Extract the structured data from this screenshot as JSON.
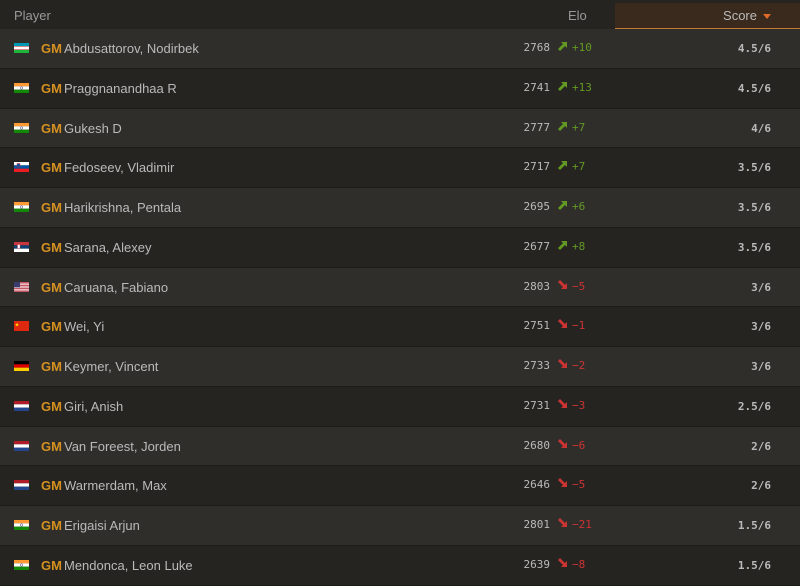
{
  "header": {
    "player": "Player",
    "elo": "Elo",
    "score": "Score"
  },
  "colors": {
    "title": "#d59120",
    "up": "#629924",
    "down": "#cc3333",
    "accent": "#e06a2a"
  },
  "rows": [
    {
      "flag": "uz",
      "title": "GM",
      "name": "Abdusattorov, Nodirbek",
      "elo": "2768",
      "dir": "up",
      "delta": "+10",
      "score": "4.5/6"
    },
    {
      "flag": "in",
      "title": "GM",
      "name": "Praggnanandhaa R",
      "elo": "2741",
      "dir": "up",
      "delta": "+13",
      "score": "4.5/6"
    },
    {
      "flag": "in",
      "title": "GM",
      "name": "Gukesh D",
      "elo": "2777",
      "dir": "up",
      "delta": "+7",
      "score": "4/6"
    },
    {
      "flag": "si",
      "title": "GM",
      "name": "Fedoseev, Vladimir",
      "elo": "2717",
      "dir": "up",
      "delta": "+7",
      "score": "3.5/6"
    },
    {
      "flag": "in",
      "title": "GM",
      "name": "Harikrishna, Pentala",
      "elo": "2695",
      "dir": "up",
      "delta": "+6",
      "score": "3.5/6"
    },
    {
      "flag": "rs",
      "title": "GM",
      "name": "Sarana, Alexey",
      "elo": "2677",
      "dir": "up",
      "delta": "+8",
      "score": "3.5/6"
    },
    {
      "flag": "us",
      "title": "GM",
      "name": "Caruana, Fabiano",
      "elo": "2803",
      "dir": "down",
      "delta": "−5",
      "score": "3/6"
    },
    {
      "flag": "cn",
      "title": "GM",
      "name": "Wei, Yi",
      "elo": "2751",
      "dir": "down",
      "delta": "−1",
      "score": "3/6"
    },
    {
      "flag": "de",
      "title": "GM",
      "name": "Keymer, Vincent",
      "elo": "2733",
      "dir": "down",
      "delta": "−2",
      "score": "3/6"
    },
    {
      "flag": "nl",
      "title": "GM",
      "name": "Giri, Anish",
      "elo": "2731",
      "dir": "down",
      "delta": "−3",
      "score": "2.5/6"
    },
    {
      "flag": "nl",
      "title": "GM",
      "name": "Van Foreest, Jorden",
      "elo": "2680",
      "dir": "down",
      "delta": "−6",
      "score": "2/6"
    },
    {
      "flag": "nl",
      "title": "GM",
      "name": "Warmerdam, Max",
      "elo": "2646",
      "dir": "down",
      "delta": "−5",
      "score": "2/6"
    },
    {
      "flag": "in",
      "title": "GM",
      "name": "Erigaisi Arjun",
      "elo": "2801",
      "dir": "down",
      "delta": "−21",
      "score": "1.5/6"
    },
    {
      "flag": "in",
      "title": "GM",
      "name": "Mendonca, Leon Luke",
      "elo": "2639",
      "dir": "down",
      "delta": "−8",
      "score": "1.5/6"
    }
  ]
}
